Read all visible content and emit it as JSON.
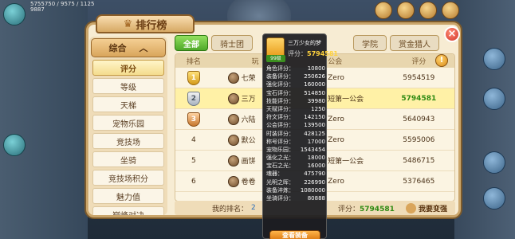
{
  "hud": {
    "top_line1": "5755750 / 9575 / 1125",
    "top_line2": "9887"
  },
  "window": {
    "title": "排行榜"
  },
  "left_menu": {
    "header": "综合",
    "items": [
      "评分",
      "等级",
      "天梯",
      "宠物乐园",
      "竞技场",
      "坐骑",
      "竞技场积分",
      "魅力值",
      "巅峰对决"
    ],
    "active_index": 0
  },
  "tabs": {
    "items": [
      "全部",
      "骑士团",
      "学院",
      "赏金猎人"
    ],
    "active_index": 0
  },
  "table": {
    "headers": {
      "rank": "排名",
      "player": "玩",
      "guild": "公会",
      "score": "评分"
    },
    "rows": [
      {
        "rank": "1",
        "player": "七荣",
        "guild": "Zero",
        "score": "5954519"
      },
      {
        "rank": "2",
        "player": "三万",
        "guild": "短第一公会",
        "score": "5794581"
      },
      {
        "rank": "3",
        "player": "六陆",
        "guild": "Zero",
        "score": "5640943"
      },
      {
        "rank": "4",
        "player": "默公",
        "guild": "Zero",
        "score": "5595006"
      },
      {
        "rank": "5",
        "player": "画饼",
        "guild": "短第一公会",
        "score": "5486715"
      },
      {
        "rank": "6",
        "player": "卷卷",
        "guild": "Zero",
        "score": "5376465"
      }
    ]
  },
  "footer": {
    "my_rank_label": "我的排名：",
    "my_rank": "2",
    "score_label": "评分：",
    "score": "5794581",
    "change_label": "我要变强"
  },
  "popup": {
    "name": "三万少女的梦",
    "level": "99级",
    "score_label": "评分：",
    "score": "5794581",
    "stats": [
      {
        "k": "角色评分：",
        "v": "10800"
      },
      {
        "k": "装备评分：",
        "v": "250626"
      },
      {
        "k": "强化评分：",
        "v": "160000"
      },
      {
        "k": "宝石评分：",
        "v": "514850"
      },
      {
        "k": "技能评分：",
        "v": "39980"
      },
      {
        "k": "天赋评分：",
        "v": "1250"
      },
      {
        "k": "符文评分：",
        "v": "142150"
      },
      {
        "k": "公会评分：",
        "v": "139500"
      },
      {
        "k": "时装评分：",
        "v": "428125"
      },
      {
        "k": "称号评分：",
        "v": "17000"
      },
      {
        "k": "宠物乐园：",
        "v": "1543454"
      },
      {
        "k": "强化之光：",
        "v": "18000"
      },
      {
        "k": "宝石之光：",
        "v": "16000"
      },
      {
        "k": "魂器：",
        "v": "475790"
      },
      {
        "k": "光明之晖：",
        "v": "226990"
      },
      {
        "k": "装备淬炼：",
        "v": "1080000"
      },
      {
        "k": "坐骑评分：",
        "v": "80888"
      }
    ],
    "button": "查看装备"
  },
  "close_label": "×",
  "info_label": "!"
}
